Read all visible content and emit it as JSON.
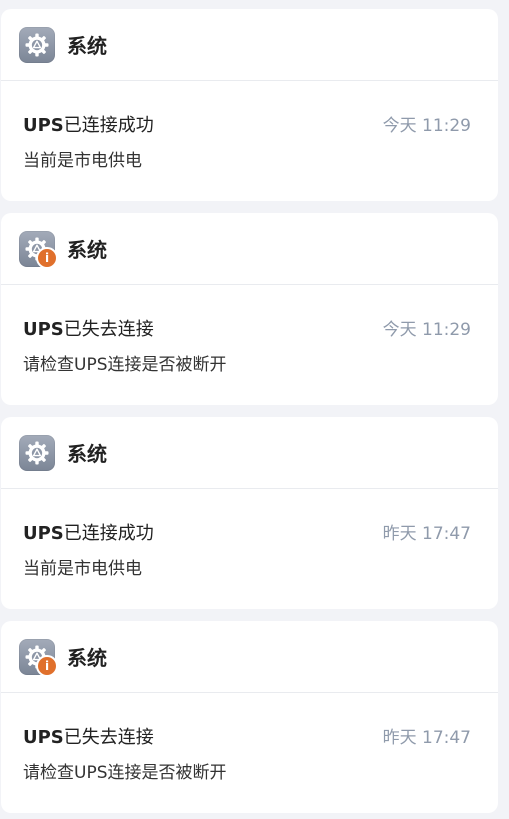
{
  "notifications": [
    {
      "app_name": "系统",
      "icon": "system-gear-icon",
      "has_badge": false,
      "title_prefix": "UPS",
      "title_rest": "已连接成功",
      "time": "今天 11:29",
      "body": "当前是市电供电"
    },
    {
      "app_name": "系统",
      "icon": "system-gear-icon",
      "has_badge": true,
      "badge_text": "i",
      "title_prefix": "UPS",
      "title_rest": "已失去连接",
      "time": "今天 11:29",
      "body": "请检查UPS连接是否被断开"
    },
    {
      "app_name": "系统",
      "icon": "system-gear-icon",
      "has_badge": false,
      "title_prefix": "UPS",
      "title_rest": "已连接成功",
      "time": "昨天 17:47",
      "body": "当前是市电供电"
    },
    {
      "app_name": "系统",
      "icon": "system-gear-icon",
      "has_badge": true,
      "badge_text": "i",
      "title_prefix": "UPS",
      "title_rest": "已失去连接",
      "time": "昨天 17:47",
      "body": "请检查UPS连接是否被断开"
    }
  ],
  "colors": {
    "page_background": "#f2f3f7",
    "card_background": "#ffffff",
    "badge_warning": "#e0702c",
    "time_text": "#8f9aab",
    "icon_gradient_top": "#a3abb9",
    "icon_gradient_bottom": "#7b8596"
  }
}
